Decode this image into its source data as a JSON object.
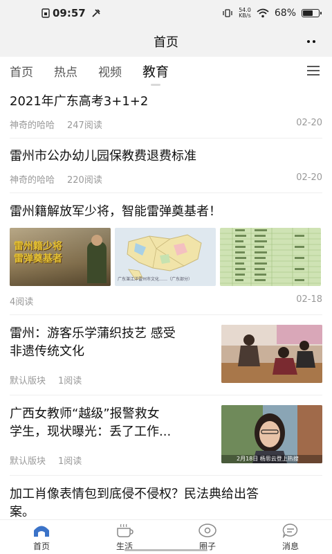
{
  "status_bar": {
    "time": "09:57",
    "net_speed_value": "54.0",
    "net_speed_unit": "KB/s",
    "battery": "68%",
    "battery_level": 0.68
  },
  "header": {
    "title": "首页"
  },
  "tabs": [
    {
      "label": "首页",
      "active": false
    },
    {
      "label": "热点",
      "active": false
    },
    {
      "label": "视频",
      "active": false
    },
    {
      "label": "教育",
      "active": true
    }
  ],
  "feed": [
    {
      "title": "2021年广东高考3+1+2",
      "author": "神奇的哈哈",
      "reads": "247阅读",
      "date": "02-20"
    },
    {
      "title": "雷州市公办幼儿园保教费退费标准",
      "author": "神奇的哈哈",
      "reads": "220阅读",
      "date": "02-20"
    },
    {
      "title": "雷州籍解放军少将，智能雷弹奠基者！",
      "reads": "4阅读",
      "date": "02-18",
      "image1_text_line1": "雷州籍少将",
      "image1_text_line2": "雷弹奠基者",
      "image2_caption": "广东湛江洋雷州市文化……（广东部分）"
    },
    {
      "title_line1": "雷州：游客乐学蒲织技艺 感受",
      "title_line2": "非遗传统文化",
      "author": "默认版块",
      "reads": "1阅读"
    },
    {
      "title_line1": "广西女教师“越级”报警救女",
      "title_line2": "学生，现状曝光：丢了工作...",
      "author": "默认版块",
      "reads": "1阅读",
      "image_caption": "2月18日 杨思云登上热搜"
    },
    {
      "title_line1": "加工肖像表情包到底侵不侵权？民法典给出答",
      "title_line2": "案。"
    }
  ],
  "bottom_nav": [
    {
      "label": "首页",
      "icon": "home-icon",
      "active": true
    },
    {
      "label": "生活",
      "icon": "cup-icon",
      "active": false
    },
    {
      "label": "圈子",
      "icon": "circle-icon",
      "active": false
    },
    {
      "label": "消息",
      "icon": "message-icon",
      "active": false
    }
  ],
  "colors": {
    "accent": "#3b73c8",
    "meta": "#999999",
    "header_bg": "#f2f2f2"
  }
}
